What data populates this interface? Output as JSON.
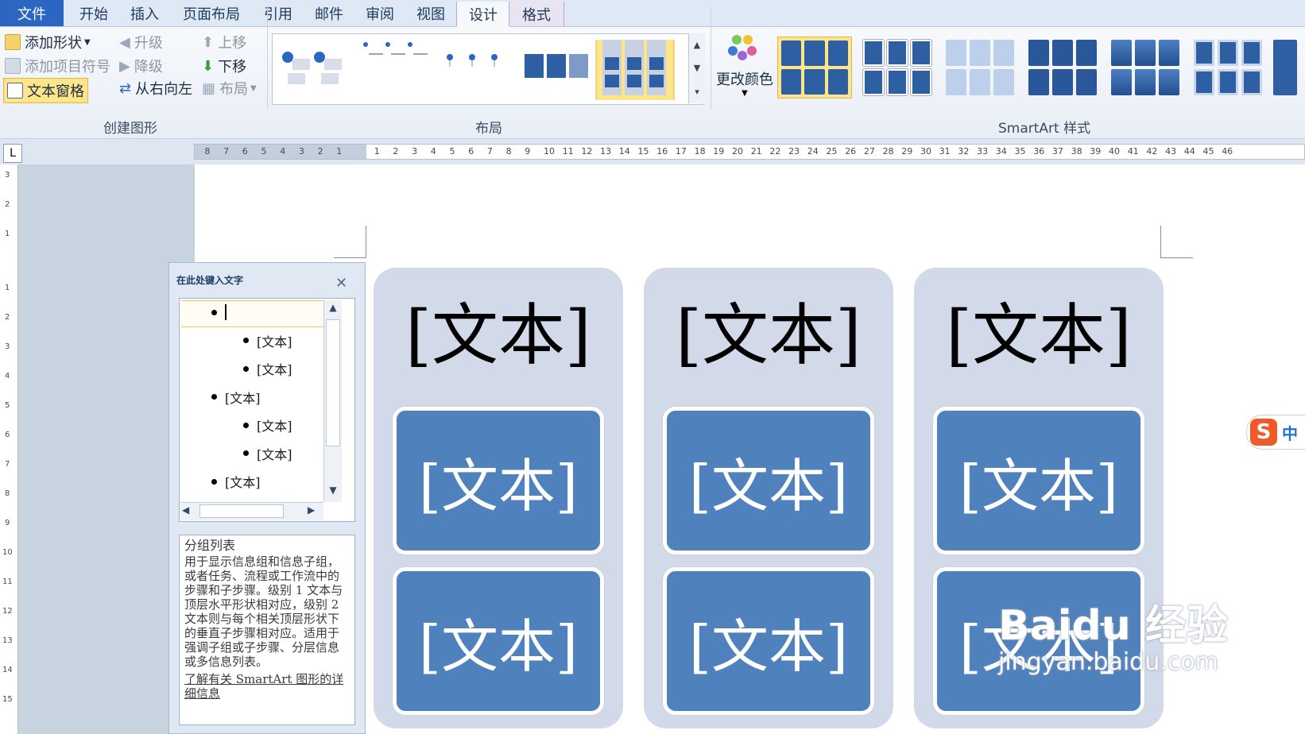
{
  "tabs": {
    "file": "文件",
    "items": [
      "开始",
      "插入",
      "页面布局",
      "引用",
      "邮件",
      "审阅",
      "视图"
    ],
    "context": [
      "设计",
      "格式"
    ]
  },
  "ribbon": {
    "create_group": {
      "label": "创建图形",
      "add_shape": "添加形状",
      "add_bullet": "添加项目符号",
      "text_pane": "文本窗格",
      "promote": "升级",
      "demote": "降级",
      "right_to_left": "从右向左",
      "move_up": "上移",
      "move_down": "下移",
      "layout": "布局"
    },
    "layout_group": {
      "label": "布局"
    },
    "styles_group": {
      "label": "SmartArt 样式",
      "change_colors": "更改颜色"
    }
  },
  "ruler": {
    "left_ticks": [
      "8",
      "7",
      "6",
      "5",
      "4",
      "3",
      "2",
      "1"
    ],
    "right_ticks": [
      "1",
      "2",
      "3",
      "4",
      "5",
      "6",
      "7",
      "8",
      "9",
      "10",
      "11",
      "12",
      "13",
      "14",
      "15",
      "16",
      "17",
      "18",
      "19",
      "20",
      "21",
      "22",
      "23",
      "24",
      "25",
      "26",
      "27",
      "28",
      "29",
      "30",
      "31",
      "32",
      "33",
      "34",
      "35",
      "36",
      "37",
      "38",
      "39",
      "40",
      "41",
      "42",
      "43",
      "44",
      "45",
      "46"
    ],
    "vertical_top": [
      "3",
      "2",
      "1"
    ],
    "vertical_ticks": [
      "1",
      "2",
      "3",
      "4",
      "5",
      "6",
      "7",
      "8",
      "9",
      "10",
      "11",
      "12",
      "13",
      "14",
      "15"
    ]
  },
  "text_pane": {
    "title": "在此处键入文字",
    "items": [
      {
        "level": 1,
        "text": ""
      },
      {
        "level": 2,
        "text": "[文本]"
      },
      {
        "level": 2,
        "text": "[文本]"
      },
      {
        "level": 1,
        "text": "[文本]"
      },
      {
        "level": 2,
        "text": "[文本]"
      },
      {
        "level": 2,
        "text": "[文本]"
      },
      {
        "level": 1,
        "text": "[文本]"
      }
    ],
    "desc_title": "分组列表",
    "desc_body": "用于显示信息组和信息子组，或者任务、流程或工作流中的步骤和子步骤。级别 1 文本与顶层水平形状相对应，级别 2 文本则与每个相关顶层形状下的垂直子步骤相对应。适用于强调子组或子步骤、分层信息或多信息列表。",
    "desc_link": "了解有关 SmartArt 图形的详细信息"
  },
  "smartart": {
    "columns": [
      {
        "head": "[文本]",
        "children": [
          "[文本]",
          "[文本]"
        ]
      },
      {
        "head": "[文本]",
        "children": [
          "[文本]",
          "[文本]"
        ]
      },
      {
        "head": "[文本]",
        "children": [
          "[文本]",
          "[文本]"
        ]
      }
    ],
    "colors": {
      "column_bg": "#d2d9e8",
      "box_fill": "#4f81bd",
      "accent": "#2b67c2"
    }
  },
  "ime": {
    "logo": "S",
    "mode": "中"
  },
  "watermark": {
    "brand": "Baidu 经验",
    "url": "jingyan.baidu.com"
  },
  "icons": [
    "add-shape-icon",
    "add-bullet-icon",
    "text-pane-icon",
    "promote-icon",
    "demote-icon",
    "right-to-left-icon",
    "move-up-icon",
    "move-down-icon",
    "layout-icon",
    "change-colors-icon",
    "close-icon",
    "scroll-up-icon",
    "scroll-down-icon",
    "scroll-left-icon",
    "scroll-right-icon"
  ]
}
